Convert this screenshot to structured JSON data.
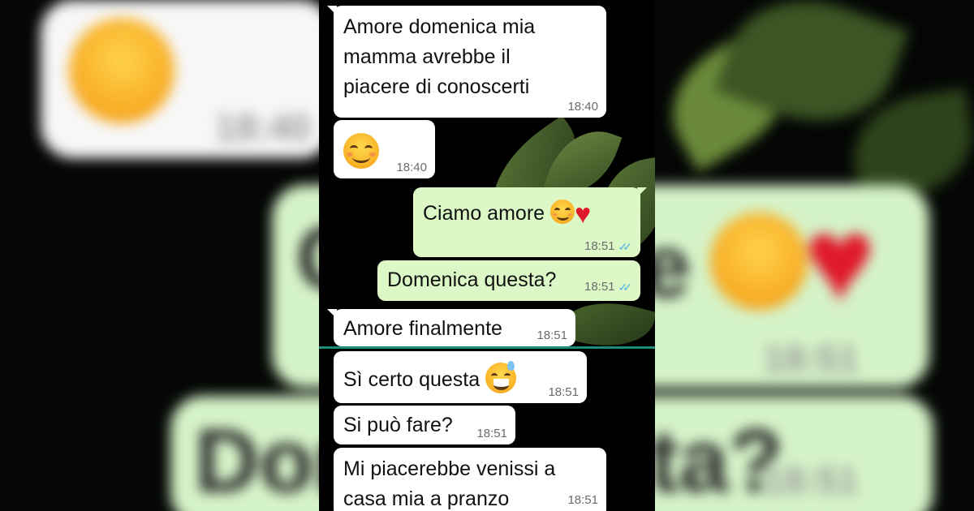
{
  "messages": [
    {
      "dir": "in",
      "text": "Amore domenica mia\nmamma avrebbe il\npiacere di conoscerti",
      "time": "18:40"
    },
    {
      "dir": "in",
      "emoji": "smiling-face-icon",
      "time": "18:40"
    },
    {
      "dir": "out",
      "text": "Ciamo amore",
      "emoji": [
        "smiling-face-icon",
        "red-heart-icon"
      ],
      "time": "18:51",
      "status": "read"
    },
    {
      "dir": "out",
      "text": "Domenica questa?",
      "time": "18:51",
      "status": "read"
    },
    {
      "dir": "in",
      "text": "Amore finalmente",
      "time": "18:51"
    },
    {
      "dir": "in",
      "text": "Sì certo questa",
      "emoji": "grinning-sweat-icon",
      "time": "18:51"
    },
    {
      "dir": "in",
      "text": "Si può fare?",
      "time": "18:51"
    },
    {
      "dir": "in",
      "text": "Mi piacerebbe venissi a\ncasa mia a pranzo",
      "time": "18:51"
    }
  ],
  "background": {
    "left_time": "18:40",
    "right_text_1": "e",
    "right_time_1": "18:51",
    "right_text_2": "Dom",
    "right_text_3": "ta?",
    "right_time_2": "18:51"
  },
  "colors": {
    "incoming": "#ffffff",
    "outgoing": "#dcf8c6",
    "read_tick": "#4fb3e8",
    "divider": "#1b8c7a"
  }
}
